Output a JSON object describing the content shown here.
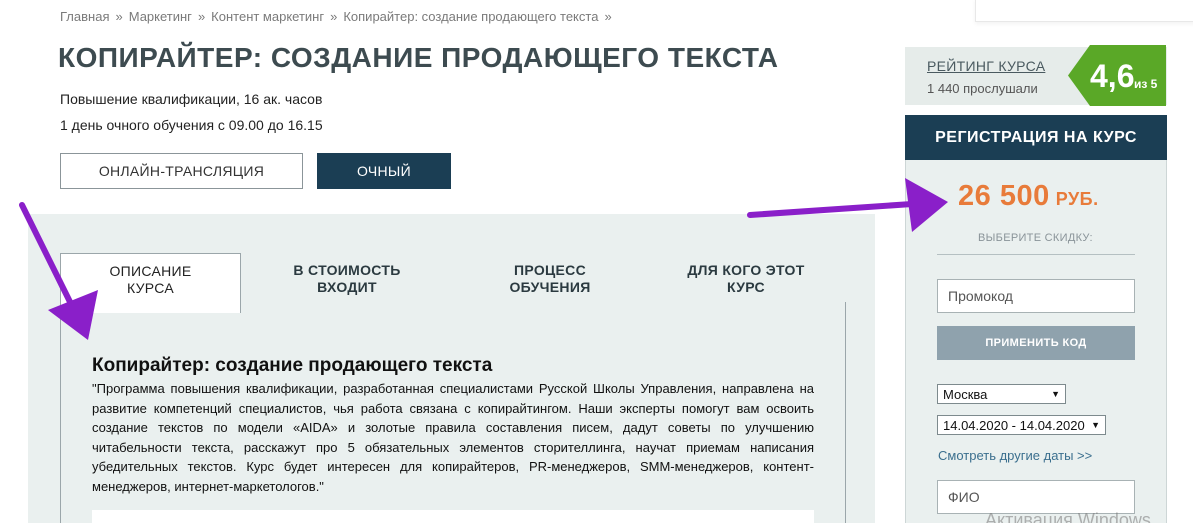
{
  "breadcrumb": {
    "items": [
      "Главная",
      "Маркетинг",
      "Контент маркетинг",
      "Копирайтер: создание продающего текста"
    ],
    "separator": "»"
  },
  "course": {
    "title": "КОПИРАЙТЕР: СОЗДАНИЕ ПРОДАЮЩЕГО ТЕКСТА",
    "meta_hours": "Повышение квалификации, 16 ак. часов",
    "meta_schedule": "1 день очного обучения с 09.00 до 16.15"
  },
  "modes": {
    "online": "ОНЛАЙН-ТРАНСЛЯЦИЯ",
    "offline": "ОЧНЫЙ",
    "selected": "ОЧНЫЙ"
  },
  "tabs": [
    {
      "label": "ОПИСАНИЕ КУРСА",
      "active": true
    },
    {
      "label": "В СТОИМОСТЬ ВХОДИТ",
      "active": false
    },
    {
      "label": "ПРОЦЕСС ОБУЧЕНИЯ",
      "active": false
    },
    {
      "label": "ДЛЯ КОГО ЭТОТ КУРС",
      "active": false
    }
  ],
  "description": {
    "heading": "Копирайтер: создание продающего текста",
    "text": "\"Программа повышения квалификации, разработанная специалистами Русской Школы Управления, направлена на развитие компетенций специалистов, чья работа связана с копирайтингом. Наши эксперты помогут вам освоить создание текстов по модели «AIDA» и золотые правила составления писем, дадут советы по улучшению читабельности текста, расскажут про 5 обязательных элементов сторителлинга, научат приемам написания убедительных текстов. Курс будет интересен для копирайтеров, PR-менеджеров, SMM-менеджеров, контент-менеджеров, интернет-маркетологов.\""
  },
  "rating": {
    "link": "РЕЙТИНГ КУРСА",
    "count": "1 440 прослушали",
    "value": "4,6",
    "of": "из 5",
    "badge_color": "#5aa827"
  },
  "registration": {
    "header": "РЕГИСТРАЦИЯ НА КУРС",
    "price": "26 500",
    "currency": "РУБ.",
    "discount_label": "ВЫБЕРИТЕ СКИДКУ:",
    "promo_placeholder": "Промокод",
    "apply_button": "ПРИМЕНИТЬ КОД",
    "city": "Москва",
    "dates": "14.04.2020 - 14.04.2020",
    "other_dates": "Смотреть другие даты >>",
    "fio_placeholder": "ФИО"
  },
  "watermark": "Активация Windows",
  "colors": {
    "brand_dark": "#1b3e54",
    "price": "#e87b3a",
    "annotation_arrow": "#8a1fc9"
  }
}
